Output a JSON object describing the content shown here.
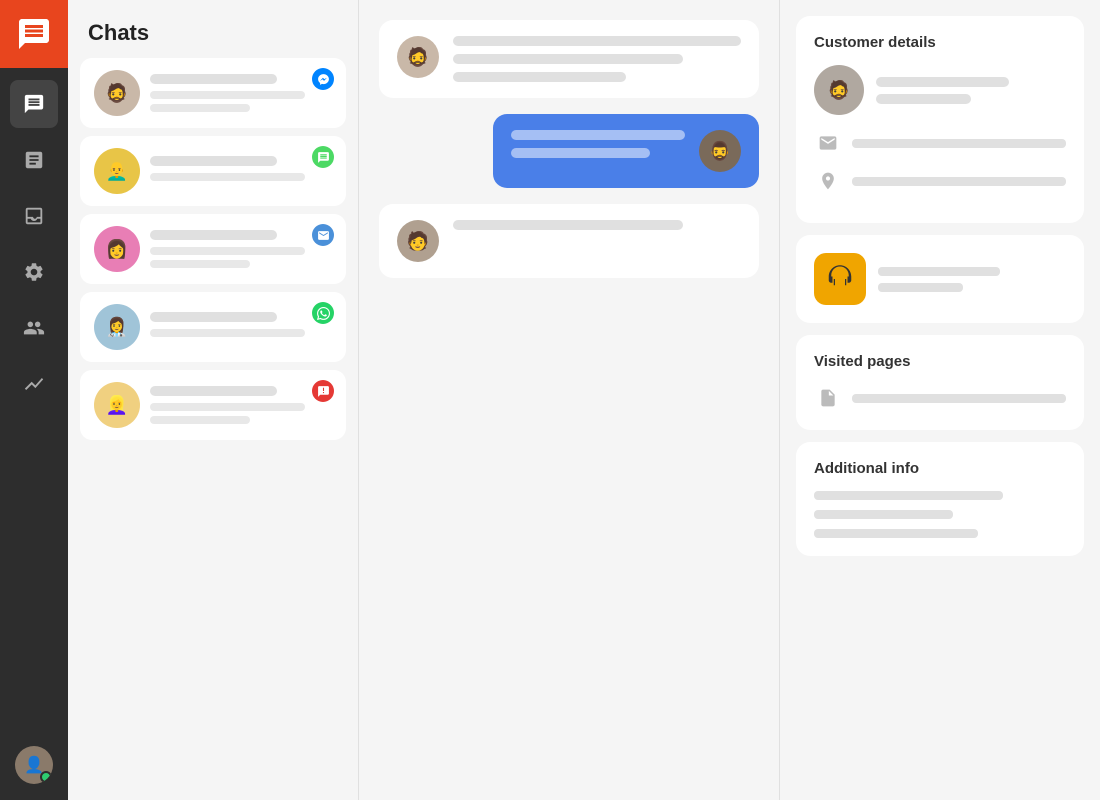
{
  "sidebar": {
    "logo_icon": "chat-icon",
    "items": [
      {
        "name": "chats",
        "label": "Chats",
        "active": true
      },
      {
        "name": "tickets",
        "label": "Tickets",
        "active": false
      },
      {
        "name": "inbox",
        "label": "Inbox",
        "active": false
      },
      {
        "name": "automation",
        "label": "Automation",
        "active": false
      },
      {
        "name": "contacts",
        "label": "Contacts",
        "active": false
      },
      {
        "name": "reports",
        "label": "Reports",
        "active": false
      }
    ]
  },
  "header": {
    "title": "Chats"
  },
  "right_panel": {
    "customer_details_title": "Customer details",
    "visited_pages_title": "Visited pages",
    "additional_info_title": "Additional info"
  }
}
